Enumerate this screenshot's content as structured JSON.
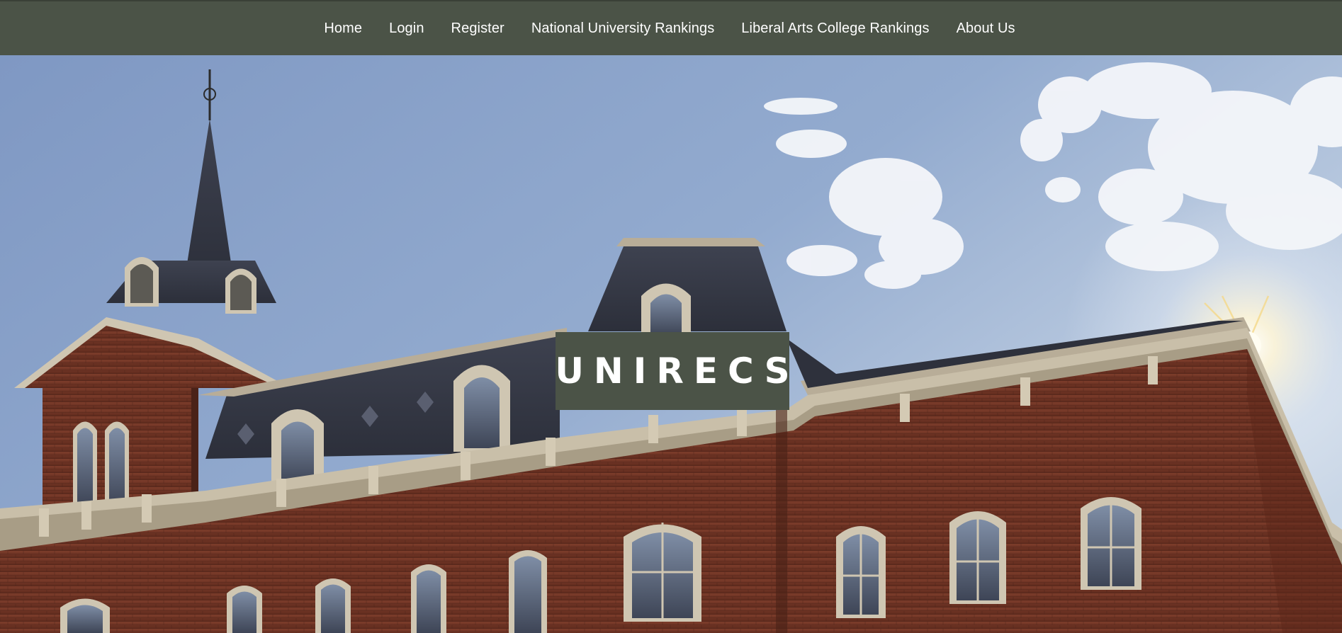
{
  "nav": {
    "items": [
      {
        "label": "Home"
      },
      {
        "label": "Login"
      },
      {
        "label": "Register"
      },
      {
        "label": "National University Rankings"
      },
      {
        "label": "Liberal Arts College Rankings"
      },
      {
        "label": "About Us"
      }
    ]
  },
  "hero": {
    "title": "UNIRECS",
    "image": "university-building-photo"
  },
  "colors": {
    "nav_bg": "#4b5347",
    "title_bg": "#4b5347",
    "text": "#ffffff",
    "brick": "#7a3b2a",
    "sky": "#8ea6c9"
  }
}
